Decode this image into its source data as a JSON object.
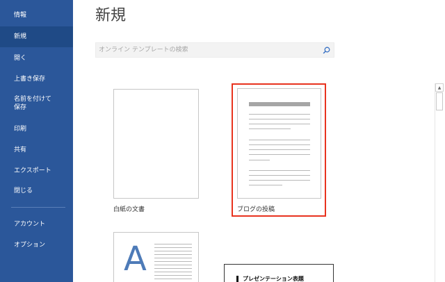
{
  "sidebar": {
    "items": [
      {
        "label": "情報"
      },
      {
        "label": "新規"
      },
      {
        "label": "開く"
      },
      {
        "label": "上書き保存"
      },
      {
        "label": "名前を付けて\n保存"
      },
      {
        "label": "印刷"
      },
      {
        "label": "共有"
      },
      {
        "label": "エクスポート"
      },
      {
        "label": "閉じる"
      },
      {
        "label": "アカウント"
      },
      {
        "label": "オプション"
      }
    ],
    "active_index": 1
  },
  "main": {
    "title": "新規",
    "search": {
      "placeholder": "オンライン テンプレートの検索",
      "icon": "search-icon"
    },
    "templates": [
      {
        "label": "白紙の文書"
      },
      {
        "label": "ブログの投稿",
        "selected": true
      },
      {
        "label": "",
        "thumb_letter": "A"
      },
      {
        "label": "",
        "thumb_title": "プレゼンテーション表題"
      }
    ]
  },
  "colors": {
    "sidebar_bg": "#2b579a",
    "sidebar_active": "#1f4a86",
    "selection_border": "#e8321e",
    "accent_letter": "#4e7bb8"
  }
}
